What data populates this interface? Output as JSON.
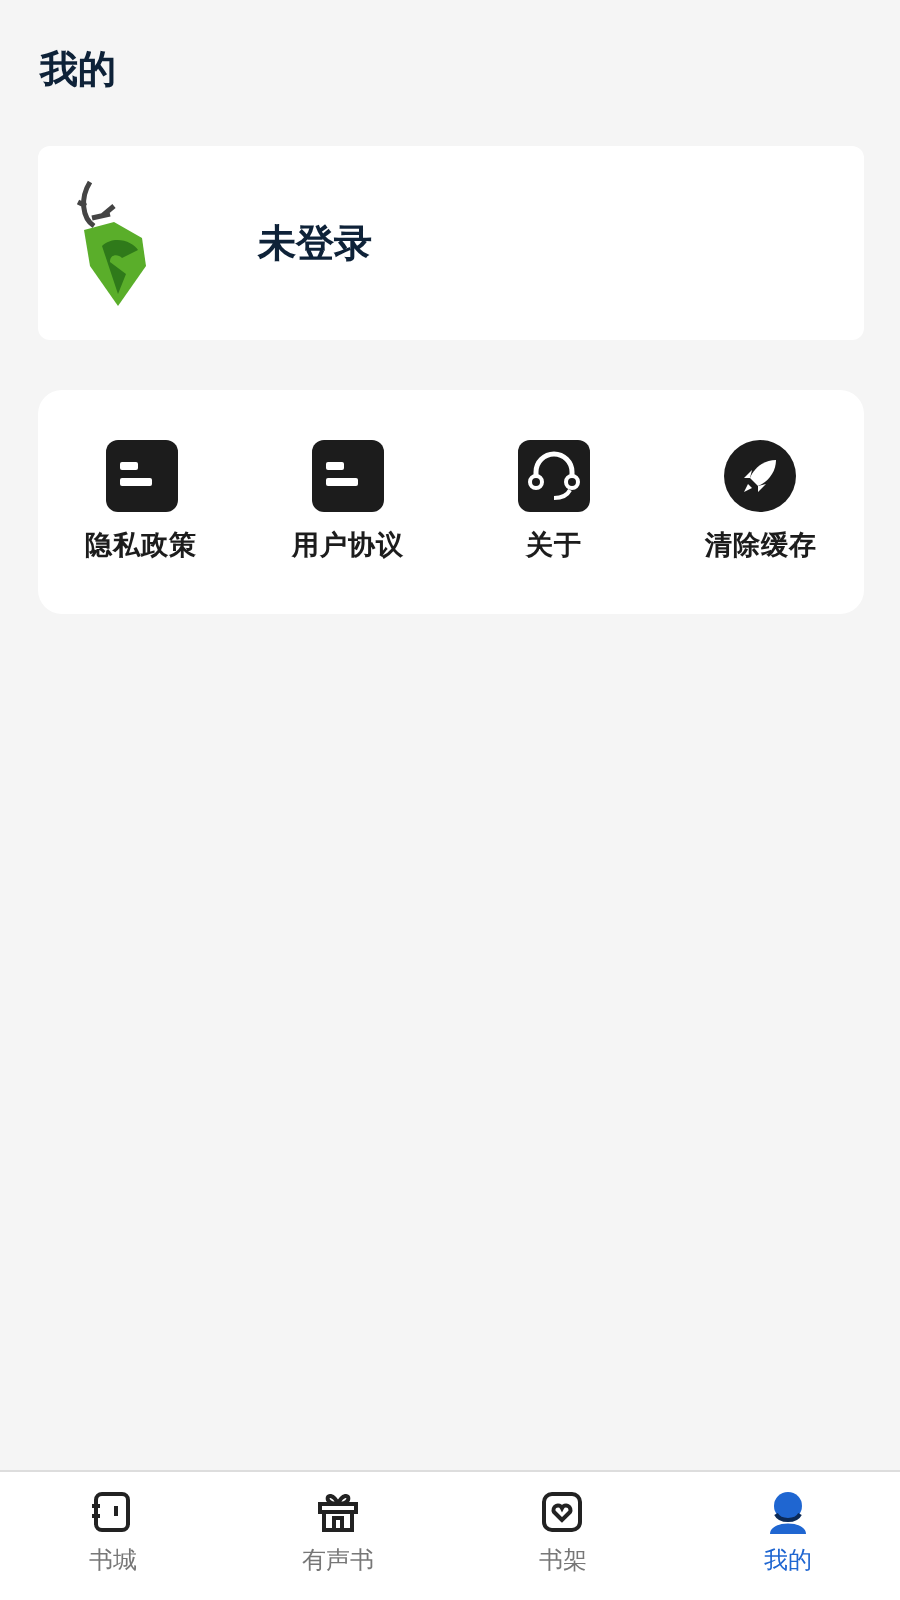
{
  "header": {
    "title": "我的"
  },
  "profile": {
    "name": "未登录"
  },
  "menu": [
    {
      "label": "隐私政策",
      "kind": "document"
    },
    {
      "label": "用户协议",
      "kind": "document"
    },
    {
      "label": "关于",
      "kind": "headset"
    },
    {
      "label": "清除缓存",
      "kind": "rocket"
    }
  ],
  "tabs": [
    {
      "label": "书城",
      "kind": "book",
      "selected": false
    },
    {
      "label": "有声书",
      "kind": "gift",
      "selected": false
    },
    {
      "label": "书架",
      "kind": "heart",
      "selected": false
    },
    {
      "label": "我的",
      "kind": "person",
      "selected": true
    }
  ]
}
